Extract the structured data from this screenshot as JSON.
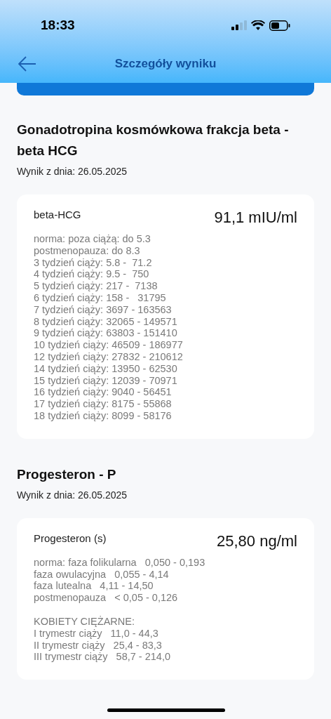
{
  "status_bar": {
    "time": "18:33"
  },
  "header": {
    "title": "Szczegóły wyniku"
  },
  "results": [
    {
      "title": "Gonadotropina kosmówkowa frakcja beta - beta HCG",
      "date": "Wynik z dnia: 26.05.2025",
      "test_name": "beta-HCG",
      "value": "91,1 mIU/ml",
      "norm_groups": [
        [
          "norma: poza ciążą: do 5.3",
          "postmenopauza: do 8.3",
          "3 tydzień ciąży: 5.8 -  71.2",
          "4 tydzień ciąży: 9.5 -  750",
          "5 tydzień ciąży: 217 -  7138",
          "6 tydzień ciąży: 158 -   31795",
          "7 tydzień ciąży: 3697 - 163563",
          "8 tydzień ciąży: 32065 - 149571",
          "9 tydzień ciąży: 63803 - 151410",
          "10 tydzień ciąży: 46509 - 186977",
          "12 tydzień ciąży: 27832 - 210612",
          "14 tydzień ciąży: 13950 - 62530",
          "15 tydzień ciąży: 12039 - 70971",
          "16 tydzień ciąży: 9040 - 56451",
          "17 tydzień ciąży: 8175 - 55868",
          "18 tydzień ciąży: 8099 - 58176"
        ]
      ]
    },
    {
      "title": "Progesteron - P",
      "date": "Wynik z dnia: 26.05.2025",
      "test_name": "Progesteron (s)",
      "value": "25,80 ng/ml",
      "norm_groups": [
        [
          "norma: faza folikularna   0,050 - 0,193",
          "faza owulacyjna   0,055 - 4,14",
          "faza lutealna   4,11 - 14,50",
          "postmenopauza   < 0,05 - 0,126"
        ],
        [
          "KOBIETY CIĘŻARNE:",
          "I trymestr ciąży   11,0 - 44,3",
          "II trymestr ciąży   25,4 - 83,3",
          "III trymestr ciąży   58,7 - 214,0"
        ]
      ]
    }
  ]
}
